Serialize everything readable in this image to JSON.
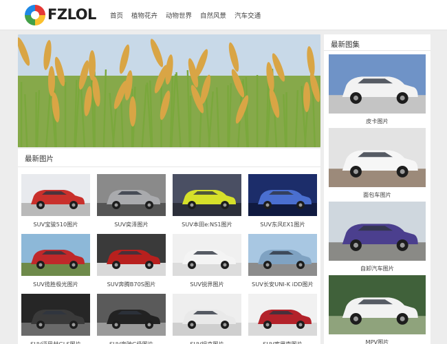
{
  "header": {
    "logo_text": "FZLOL",
    "nav": [
      "首页",
      "植物花卉",
      "动物世界",
      "自然风景",
      "汽车交通"
    ]
  },
  "latest_images": {
    "title": "最新图片",
    "items": [
      {
        "caption": "SUV宝骏510图片",
        "colors": {
          "sky": "#e8eaee",
          "car": "#c9302c",
          "ground": "#b9b9b9"
        }
      },
      {
        "caption": "SUV奕泽图片",
        "colors": {
          "sky": "#8a8a8a",
          "car": "#a9aaad",
          "ground": "#555555"
        }
      },
      {
        "caption": "SUV本田e:NS1图片",
        "colors": {
          "sky": "#4a4f63",
          "car": "#d6e02a",
          "ground": "#2c2f3a"
        }
      },
      {
        "caption": "SUV东风EX1图片",
        "colors": {
          "sky": "#1c2d6a",
          "car": "#4a6fd0",
          "ground": "#101a40"
        }
      },
      {
        "caption": "SUV揽胜极光图片",
        "colors": {
          "sky": "#8db8d8",
          "car": "#c0282a",
          "ground": "#6e8a4a"
        }
      },
      {
        "caption": "SUV奔腾B70S图片",
        "colors": {
          "sky": "#3a3a3a",
          "car": "#b8201e",
          "ground": "#d8d8d8"
        }
      },
      {
        "caption": "SUV锐界图片",
        "colors": {
          "sky": "#f0f0f0",
          "car": "#f4f4f4",
          "ground": "#dcdcdc"
        }
      },
      {
        "caption": "SUV长安UNI-K iDD图片",
        "colors": {
          "sky": "#a8c7e2",
          "car": "#7fa2c2",
          "ground": "#8c8c8c"
        }
      },
      {
        "caption": "SUV迈巴赫GLS图片",
        "colors": {
          "sky": "#262626",
          "car": "#3a3a3a",
          "ground": "#6a6a6a"
        }
      },
      {
        "caption": "SUV奔驰G级图片",
        "colors": {
          "sky": "#5a5a5a",
          "car": "#222222",
          "ground": "#9a9a9a"
        }
      },
      {
        "caption": "SUV坦克图片",
        "colors": {
          "sky": "#eeeeee",
          "car": "#e9e9e9",
          "ground": "#cfcfcf"
        }
      },
      {
        "caption": "SUV库里南图片",
        "colors": {
          "sky": "#f1f1f1",
          "car": "#b3222a",
          "ground": "#d9d9d9"
        }
      }
    ]
  },
  "latest_galleries": {
    "title": "最新图集",
    "items": [
      {
        "caption": "皮卡图片",
        "colors": {
          "sky": "#6f93c7",
          "car": "#f2f2f2",
          "ground": "#c4c4c4"
        }
      },
      {
        "caption": "面包车图片",
        "colors": {
          "sky": "#e3e3e3",
          "car": "#f6f6f6",
          "ground": "#9c8a7a"
        }
      },
      {
        "caption": "自卸汽车图片",
        "colors": {
          "sky": "#cfd7de",
          "car": "#4b3f8e",
          "ground": "#8a8a86"
        }
      },
      {
        "caption": "MPV图片",
        "colors": {
          "sky": "#40613a",
          "car": "#f2f2f2",
          "ground": "#8fa37c"
        }
      }
    ]
  },
  "banner": {
    "colors": {
      "sky": "#c8d9e8",
      "stalk": "#7aa83c",
      "grain": "#d9a545"
    }
  }
}
